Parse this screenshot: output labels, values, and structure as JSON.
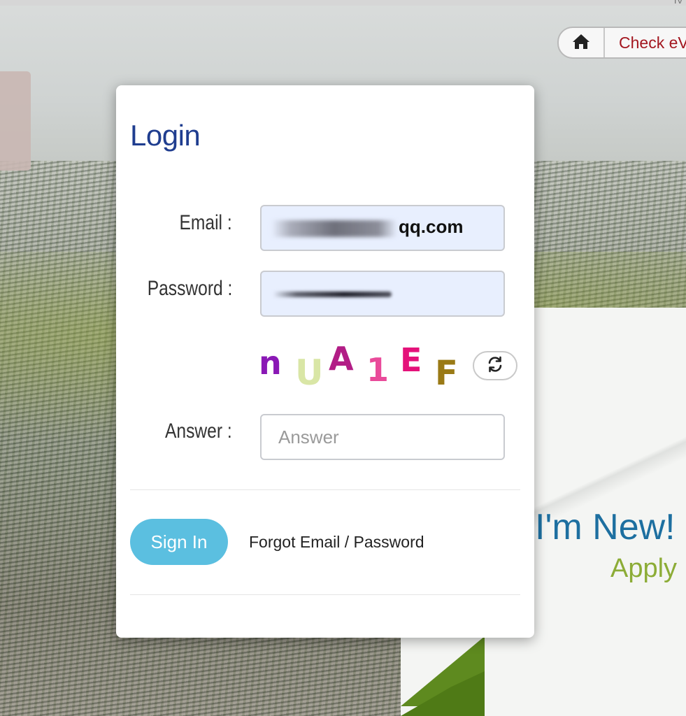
{
  "header": {
    "home_icon": "home-icon",
    "check_link": "Check eV",
    "top_right_fragment": "IV"
  },
  "background": {
    "promo_heading": "I'm New!",
    "promo_link": "Apply"
  },
  "login_modal": {
    "title": "Login",
    "email_label": "Email :",
    "email_value_visible": "qq.com",
    "password_label": "Password :",
    "captcha": {
      "characters": [
        "n",
        "U",
        "A",
        "1",
        "E",
        "F"
      ],
      "colors": [
        "#8a18b5",
        "#d9e6a6",
        "#b21d86",
        "#e94a9a",
        "#e4127a",
        "#9a7a16"
      ],
      "refresh_icon": "refresh-icon"
    },
    "answer_label": "Answer :",
    "answer_placeholder": "Answer",
    "signin_label": "Sign In",
    "forgot_link": "Forgot Email / Password"
  },
  "colors": {
    "title": "#1f3d8f",
    "signin": "#5bbfe0",
    "check_link": "#a3161f",
    "promo_heading": "#1d6fa0",
    "promo_link": "#8cac36"
  }
}
